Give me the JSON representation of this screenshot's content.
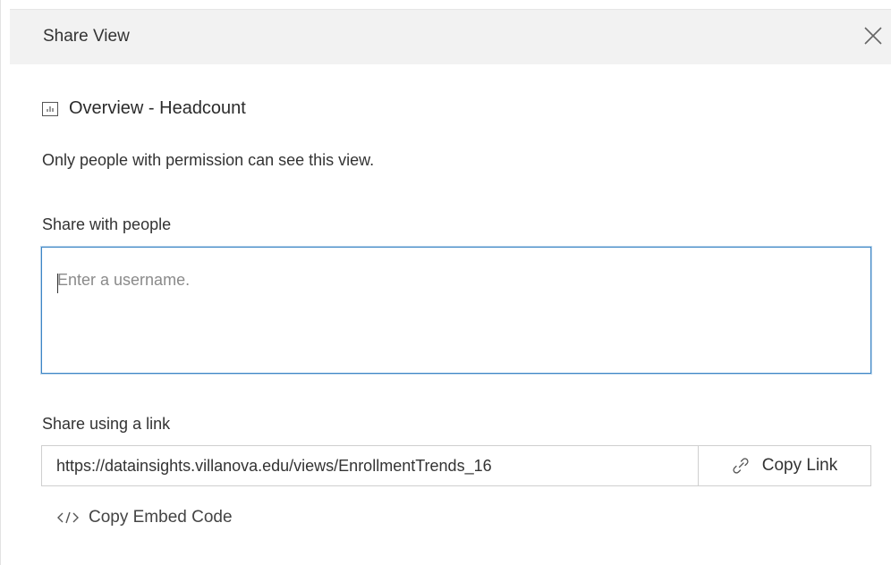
{
  "dialog": {
    "title": "Share View",
    "close_icon": "close-icon"
  },
  "view": {
    "icon": "chart-icon",
    "name": "Overview - Headcount"
  },
  "permission_text": "Only people with permission can see this view.",
  "share_people": {
    "label": "Share with people",
    "placeholder": "Enter a username."
  },
  "share_link": {
    "label": "Share using a link",
    "url": "https://datainsights.villanova.edu/views/EnrollmentTrends_16",
    "copy_label": "Copy Link",
    "copy_icon": "link-icon"
  },
  "embed": {
    "label": "Copy Embed Code",
    "icon": "code-icon"
  },
  "colors": {
    "header_bg": "#f2f2f2",
    "focus_border": "#3d86c6",
    "text": "#333333"
  }
}
